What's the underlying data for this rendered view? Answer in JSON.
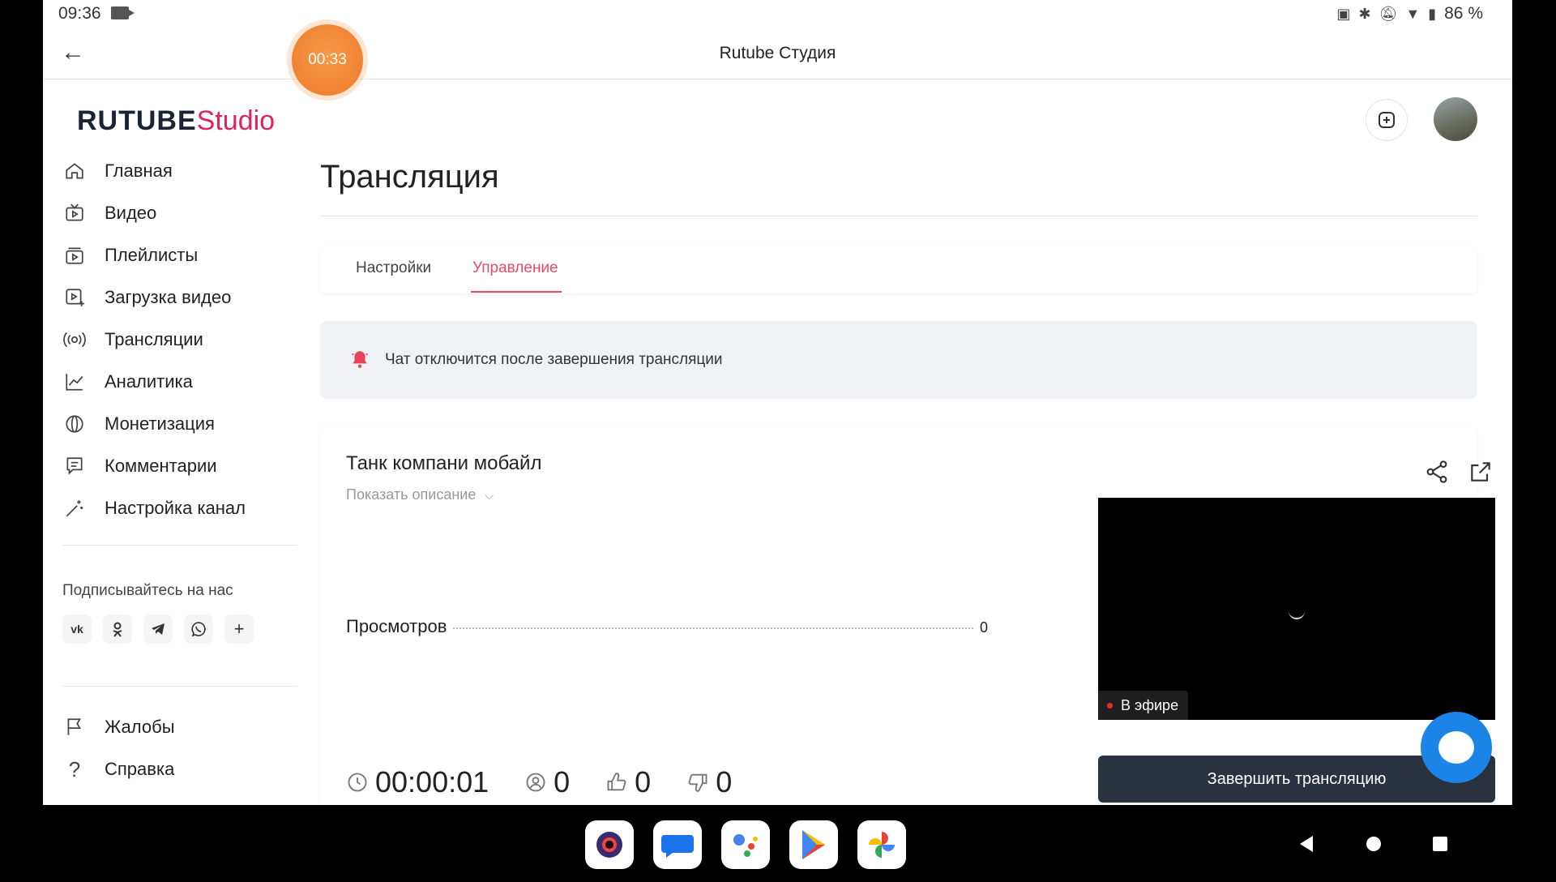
{
  "status_bar": {
    "time": "09:36",
    "battery": "86 %"
  },
  "app_bar": {
    "title": "Rutube Студия",
    "recording_timer": "00:33"
  },
  "logo": {
    "part1": "RUTUBE",
    "part2": "Studio"
  },
  "sidebar": {
    "items": [
      {
        "label": "Главная",
        "icon": "home-icon"
      },
      {
        "label": "Видео",
        "icon": "tv-icon"
      },
      {
        "label": "Плейлисты",
        "icon": "playlist-icon"
      },
      {
        "label": "Загрузка видео",
        "icon": "upload-icon"
      },
      {
        "label": "Трансляции",
        "icon": "broadcast-icon"
      },
      {
        "label": "Аналитика",
        "icon": "chart-icon"
      },
      {
        "label": "Монетизация",
        "icon": "coin-icon"
      },
      {
        "label": "Комментарии",
        "icon": "comments-icon"
      },
      {
        "label": "Настройка канал",
        "icon": "magic-wand-icon"
      }
    ],
    "follow_label": "Подписывайтесь на нас",
    "socials": [
      "vk",
      "ok",
      "telegram",
      "viber",
      "more"
    ],
    "bottom_items": [
      {
        "label": "Жалобы",
        "icon": "flag-icon"
      },
      {
        "label": "Справка",
        "icon": "help-icon"
      }
    ]
  },
  "main": {
    "title": "Трансляция",
    "tabs": [
      {
        "label": "Настройки",
        "active": false
      },
      {
        "label": "Управление",
        "active": true
      }
    ],
    "notice": "Чат отключится после завершения трансляции",
    "stream": {
      "title": "Танк компани мобайл",
      "show_description": "Показать описание",
      "views_label": "Просмотров",
      "views_value": "0",
      "live_label": "В эфире",
      "end_button": "Завершить трансляцию",
      "duration": "00:00:01",
      "viewers": "0",
      "likes": "0",
      "dislikes": "0"
    }
  },
  "colors": {
    "accent": "#e74b6b",
    "brand_pink": "#e1235a",
    "dark_button": "#2a3240",
    "timer_orange": "#ee7a2a",
    "chat_blue": "#1c84e6"
  }
}
